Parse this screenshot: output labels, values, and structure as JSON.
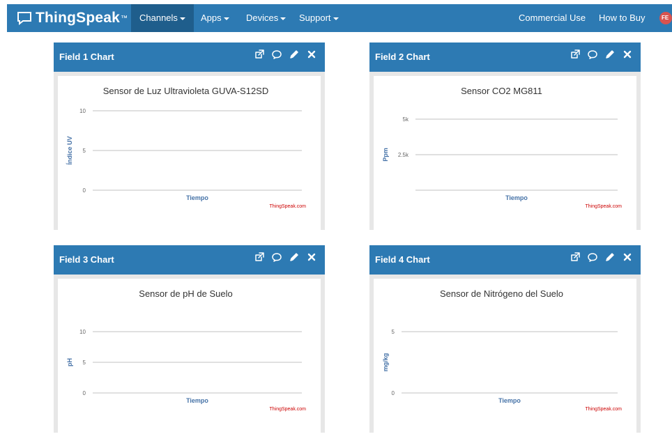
{
  "brand": {
    "name": "ThingSpeak",
    "tm": "™"
  },
  "nav": {
    "left": [
      "Channels",
      "Apps",
      "Devices",
      "Support"
    ],
    "right": [
      "Commercial Use",
      "How to Buy"
    ],
    "avatar_initials": "FE"
  },
  "panels": [
    {
      "title": "Field 1 Chart"
    },
    {
      "title": "Field 2 Chart"
    },
    {
      "title": "Field 3 Chart"
    },
    {
      "title": "Field 4 Chart"
    }
  ],
  "chart_data": [
    {
      "type": "line",
      "title": "Sensor de Luz Ultravioleta GUVA-S12SD",
      "xlabel": "Tiempo",
      "ylabel": "Índice UV",
      "y_ticks": [
        "10",
        "5",
        "0"
      ],
      "ylim": [
        0,
        10
      ],
      "series": [],
      "credit": "ThingSpeak.com"
    },
    {
      "type": "line",
      "title": "Sensor CO2 MG811",
      "xlabel": "Tiempo",
      "ylabel": "Ppm",
      "y_ticks": [
        "5k",
        "2.5k"
      ],
      "ylim": [
        0,
        5000
      ],
      "series": [],
      "credit": "ThingSpeak.com"
    },
    {
      "type": "line",
      "title": "Sensor de pH de Suelo",
      "xlabel": "Tiempo",
      "ylabel": "pH",
      "y_ticks": [
        "10",
        "5",
        "0"
      ],
      "ylim": [
        0,
        10
      ],
      "series": [],
      "credit": "ThingSpeak.com"
    },
    {
      "type": "line",
      "title": "Sensor de Nitrógeno del Suelo",
      "xlabel": "Tiempo",
      "ylabel": "mg/kg",
      "y_ticks": [
        "5",
        "0"
      ],
      "ylim": [
        0,
        5
      ],
      "series": [],
      "credit": "ThingSpeak.com"
    }
  ]
}
